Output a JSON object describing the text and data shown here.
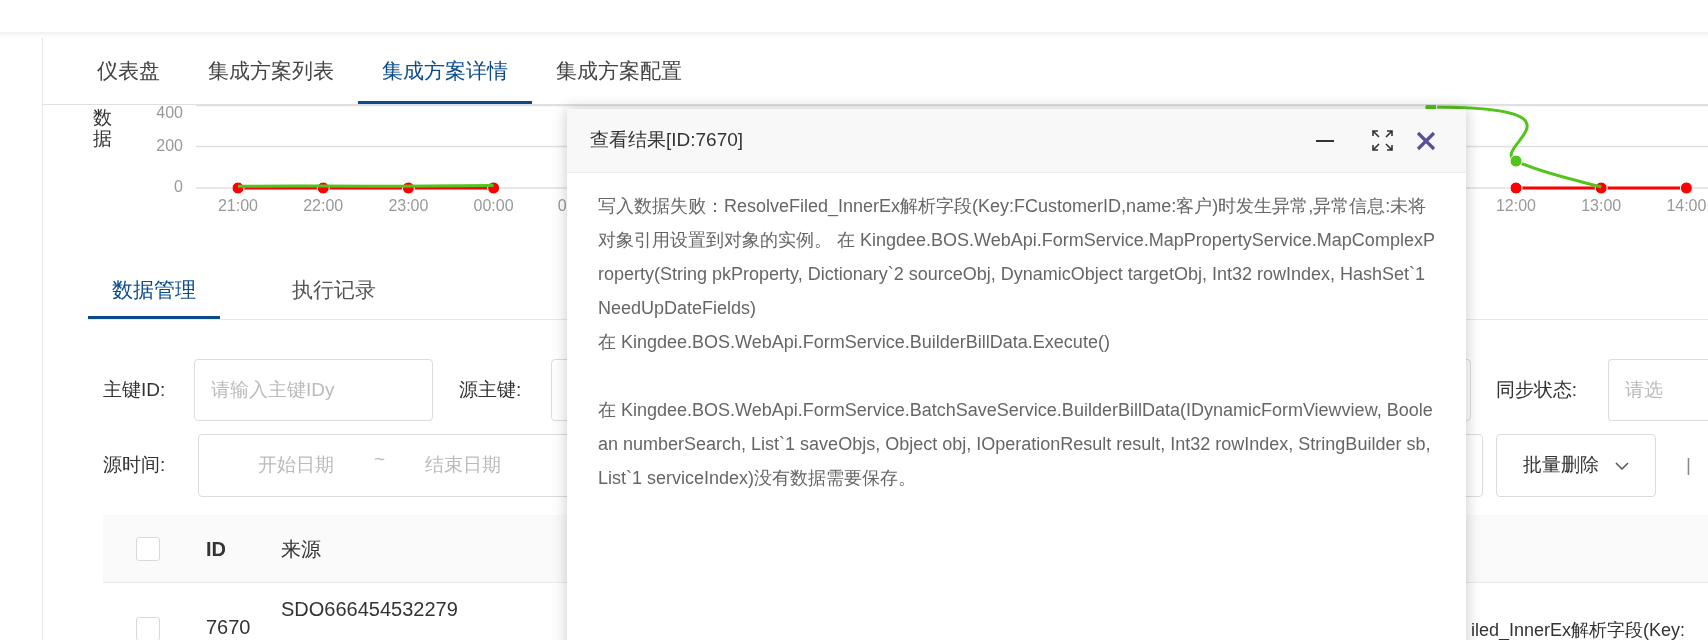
{
  "tabs": [
    {
      "label": "仪表盘",
      "selected": false
    },
    {
      "label": "集成方案列表",
      "selected": false
    },
    {
      "label": "集成方案详情",
      "selected": true
    },
    {
      "label": "集成方案配置",
      "selected": false
    }
  ],
  "chart_data": {
    "type": "line",
    "ylabel": "数据",
    "categories": [
      "21:00",
      "22:00",
      "23:00",
      "00:00",
      "0",
      null,
      null,
      null,
      null,
      null,
      null,
      null,
      null,
      null,
      null,
      "12:00",
      "13:00",
      "14:00"
    ],
    "yticks": [
      0,
      200,
      400
    ],
    "ylim": [
      0,
      400
    ],
    "series": [
      {
        "color": "#52c41a",
        "marker": true,
        "values": [
          8,
          10,
          8,
          12,
          null,
          null,
          null,
          null,
          null,
          null,
          null,
          null,
          null,
          null,
          390,
          130,
          5,
          null
        ]
      },
      {
        "color": "#ff0000",
        "marker": true,
        "values": [
          0,
          0,
          0,
          0,
          null,
          null,
          null,
          null,
          null,
          null,
          null,
          null,
          null,
          null,
          null,
          0,
          0,
          0
        ]
      }
    ]
  },
  "sub_tabs": [
    {
      "label": "数据管理",
      "selected": true
    },
    {
      "label": "执行记录",
      "selected": false
    }
  ],
  "filters": {
    "primary_key_label": "主键ID:",
    "primary_key_placeholder": "请输入主键IDy",
    "source_key_label": "源主键:",
    "sync_status_label": "同步状态:",
    "sync_status_placeholder": "请选",
    "source_time_label": "源时间:",
    "start_placeholder": "开始日期",
    "range_separator": "~",
    "end_placeholder": "结束日期",
    "bulk_delete": "批量删除",
    "separator": "|"
  },
  "table": {
    "columns": [
      "ID",
      "来源"
    ],
    "rows": [
      {
        "checked": false,
        "id": "7670",
        "source": "SDO666454532279",
        "column_3": "iled_InnerEx解析字段(Key:"
      }
    ]
  },
  "header_checked": false,
  "modal": {
    "title": "查看结果[ID:7670]",
    "paragraphs": [
      "写入数据失败：ResolveFiled_InnerEx解析字段(Key:FCustomerID,name:客户)时发生异常,异常信息:未将对象引用设置到对象的实例。 在 Kingdee.BOS.WebApi.FormService.MapPropertyService.MapComplexProperty(String pkProperty, Dictionary`2 sourceObj, DynamicObject targetObj, Int32 rowIndex, HashSet`1 NeedUpDateFields)",
      "在 Kingdee.BOS.WebApi.FormService.BuilderBillData.Execute()",
      "在 Kingdee.BOS.WebApi.FormService.BatchSaveService.BuilderBillData(IDynamicFormViewview, Boolean numberSearch, List`1 saveObjs, Object obj, IOperationResult result, Int32 rowIndex, StringBuilder sb, List`1 serviceIndex)没有数据需要保存。"
    ]
  }
}
